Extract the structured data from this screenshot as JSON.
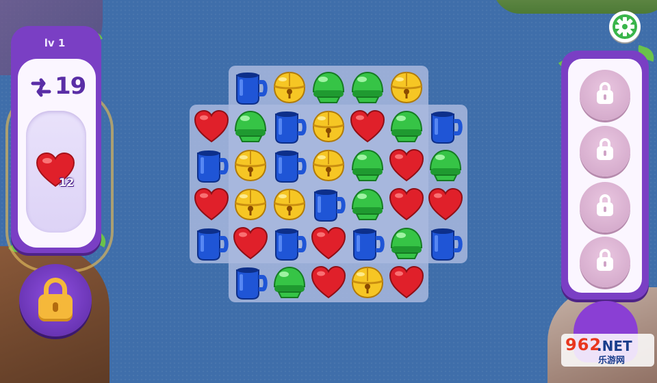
{
  "level": {
    "label": "lv 1"
  },
  "moves": {
    "count": "19",
    "icon": "moves-arrows-icon"
  },
  "goal": {
    "icon": "heart-icon",
    "count": "12"
  },
  "boosters": {
    "left_booster_icon": "padlock-icon",
    "right_slots": [
      "locked",
      "locked",
      "locked",
      "locked"
    ]
  },
  "settings": {
    "icon": "gear-icon"
  },
  "watermark": {
    "line1": "962",
    "line1b": ".NET",
    "line2": "乐游网"
  },
  "colors": {
    "heart": "#e0202a",
    "cup": "#1f55d6",
    "bell": "#f6c624",
    "dome": "#36c446",
    "panel": "#7a3fc4"
  },
  "board": {
    "rows": [
      [
        null,
        "cup",
        "bell",
        "dome",
        "dome",
        "bell",
        null
      ],
      [
        "heart",
        "dome",
        "cup",
        "bell",
        "heart",
        "dome",
        "cup"
      ],
      [
        "cup",
        "bell",
        "cup",
        "bell",
        "dome",
        "heart",
        "dome"
      ],
      [
        "heart",
        "bell",
        "bell",
        "cup",
        "dome",
        "heart",
        "heart"
      ],
      [
        "cup",
        "heart",
        "cup",
        "heart",
        "cup",
        "dome",
        "cup"
      ],
      [
        null,
        "cup",
        "dome",
        "heart",
        "bell",
        "heart",
        null
      ]
    ]
  }
}
